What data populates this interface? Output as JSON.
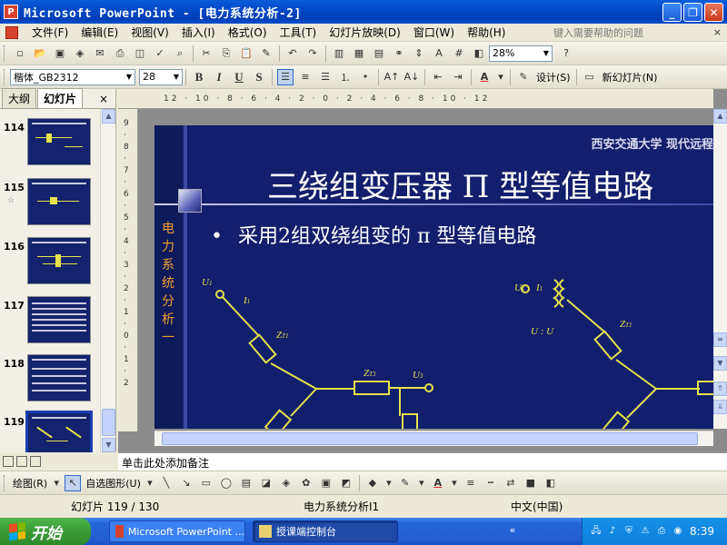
{
  "window": {
    "title": "Microsoft PowerPoint - [电力系统分析-2]",
    "minimize": "_",
    "restore": "❐",
    "close": "✕"
  },
  "menu": {
    "items": [
      "文件(F)",
      "编辑(E)",
      "视图(V)",
      "插入(I)",
      "格式(O)",
      "工具(T)",
      "幻灯片放映(D)",
      "窗口(W)",
      "帮助(H)"
    ],
    "help_placeholder": "键入需要帮助的问题",
    "close": "×"
  },
  "toolbar": {
    "zoom": "28%",
    "font": "楷体_GB2312",
    "size": "28",
    "bold": "B",
    "italic": "I",
    "underline": "U",
    "shadow": "S",
    "design_label": "设计(S)",
    "new_slide_label": "新幻灯片(N)"
  },
  "panel": {
    "tab_outline": "大纲",
    "tab_slides": "幻灯片",
    "close": "×",
    "thumbnails": [
      {
        "num": "114",
        "star": ""
      },
      {
        "num": "115",
        "star": "☆"
      },
      {
        "num": "116",
        "star": ""
      },
      {
        "num": "117",
        "star": ""
      },
      {
        "num": "118",
        "star": ""
      },
      {
        "num": "119",
        "star": ""
      }
    ]
  },
  "ruler": {
    "top": "12 · 10 · 8 · 6 · 4 · 2 · 0 · 2 · 4 · 6 · 8 · 10 · 12",
    "side": "9 · 8 · 7 · 6 · 5 · 4 · 3 · 2 · 1 · 0 · 1 · 2"
  },
  "slide": {
    "institution": "西安交通大学 现代远程",
    "title": "三绕组变压器 Π 型等值电路",
    "bullet_mark": "•",
    "bullet": "采用2组双绕组变的 π 型等值电路",
    "side_label": "电力系统分析一",
    "labels": {
      "u1": "U",
      "i1": "I",
      "zt1": "Z",
      "zt3": "Z",
      "u3": "U",
      "ratio": "U  : U",
      "sub1": "1",
      "subt1": "T1",
      "subt3": "T3",
      "sub3": "3",
      "subn": "1N",
      "sub3n": "3N"
    }
  },
  "notes": {
    "placeholder": "单击此处添加备注"
  },
  "drawbar": {
    "draw": "绘图(R)",
    "autoshapes": "自选图形(U)"
  },
  "status": {
    "slide": "幻灯片 119 / 130",
    "design": "电力系统分析I1",
    "language": "中文(中国)"
  },
  "taskbar": {
    "start": "开始",
    "task1": "Microsoft PowerPoint ...",
    "task2": "授课端控制台",
    "clock": "8:39"
  }
}
